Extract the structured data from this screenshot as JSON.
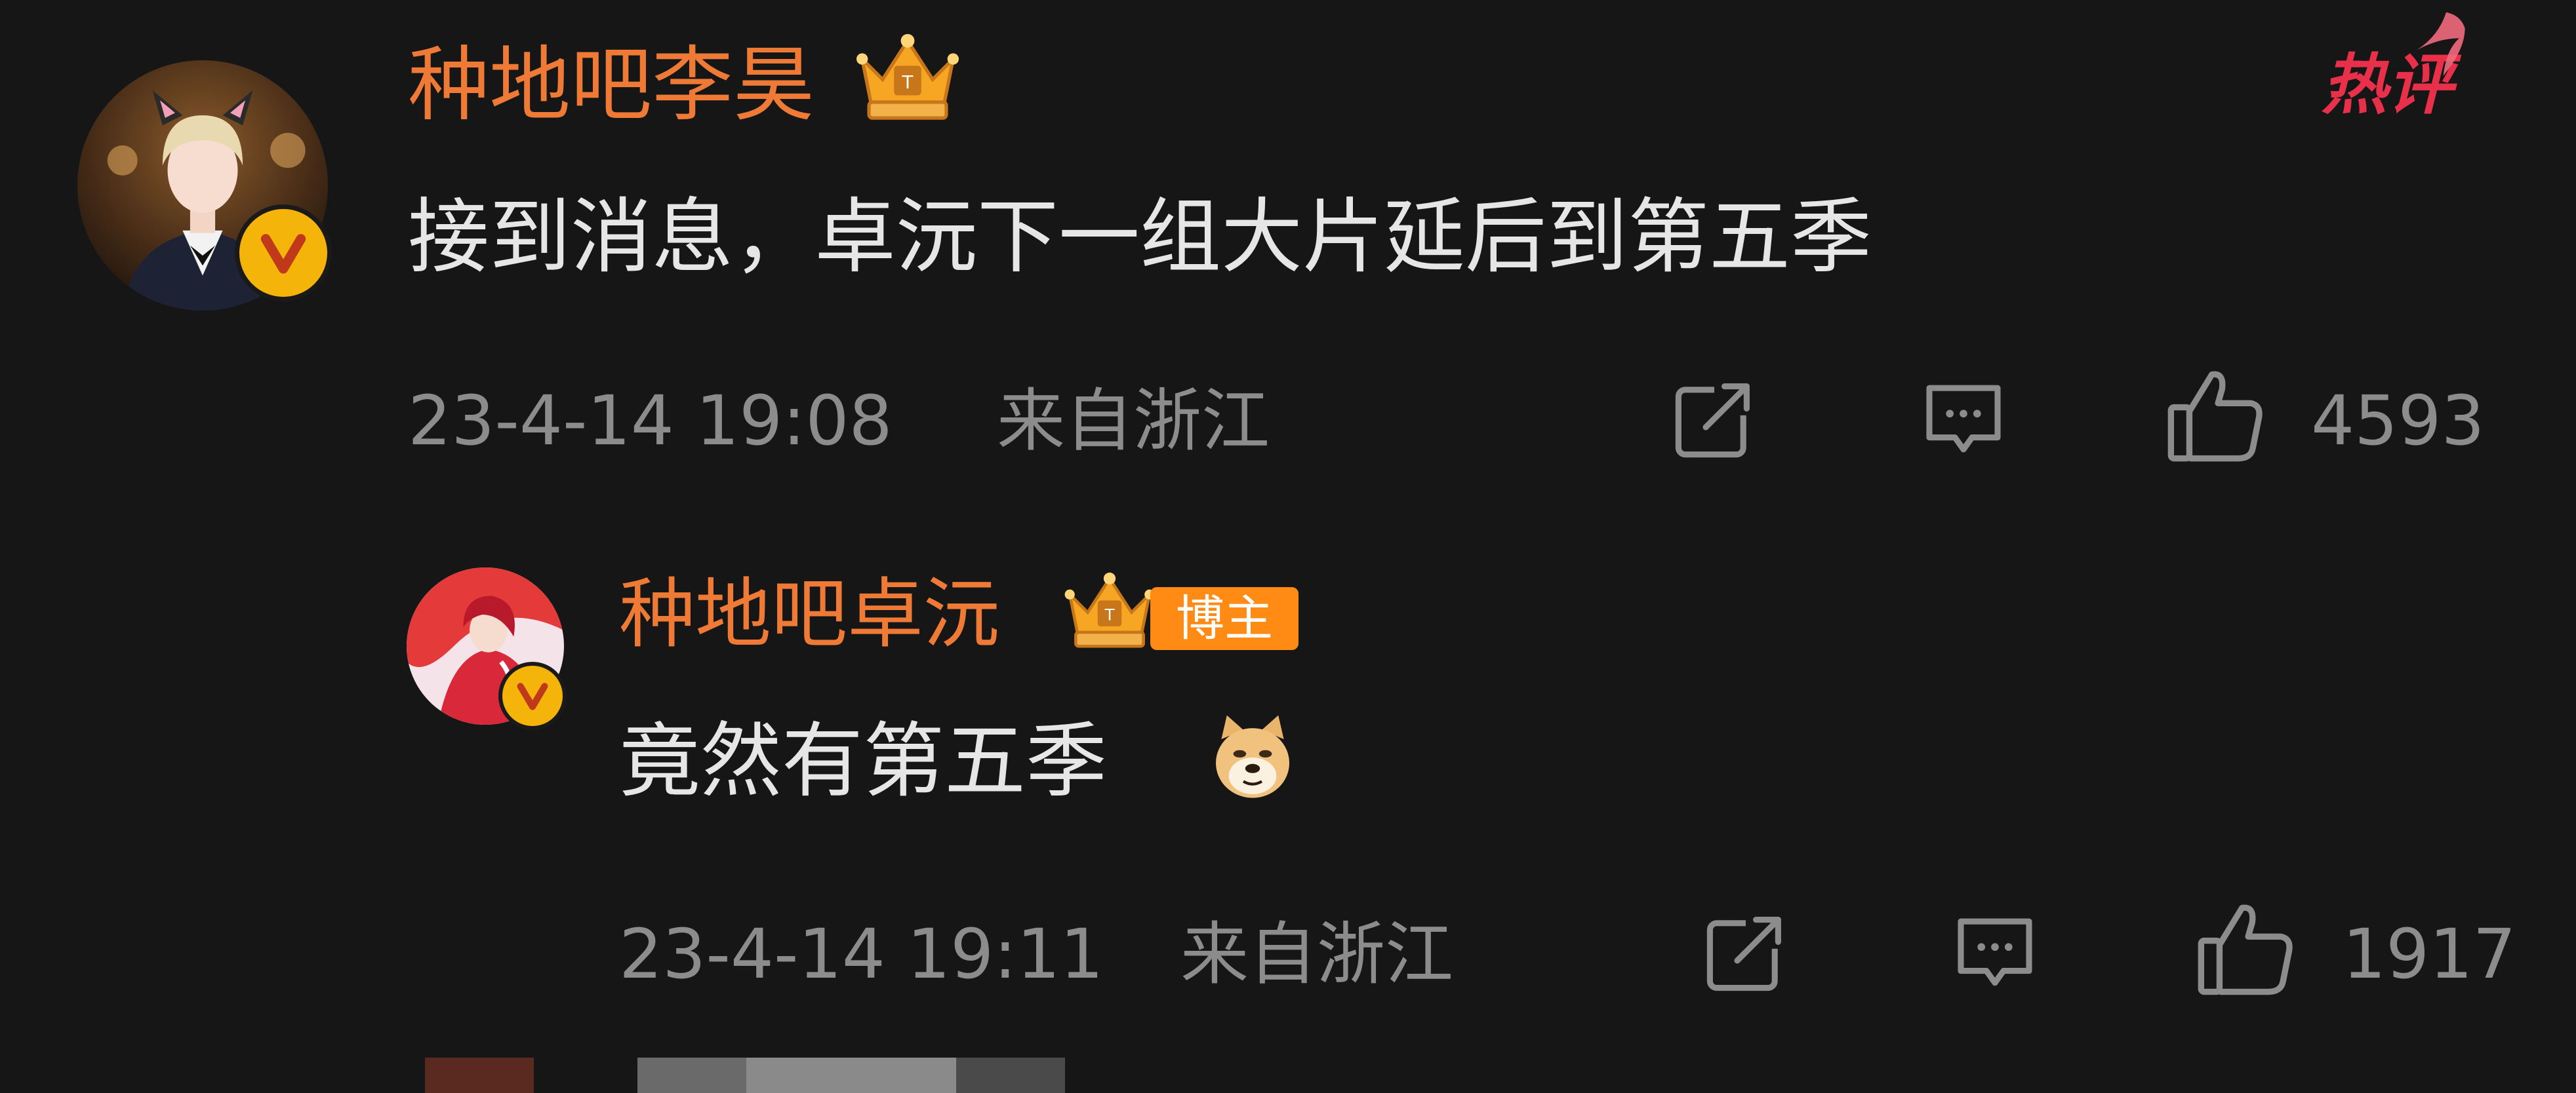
{
  "colors": {
    "background": "#161616",
    "username": "#ee7a36",
    "meta_text": "#8c8c8c",
    "comment_text": "#e6e6e6",
    "verified_badge": "#f5b40a",
    "role_badge": "#ff8a14",
    "hot_tag": "#e8304a"
  },
  "hot_tag": {
    "label": "热评"
  },
  "comments": [
    {
      "username": "种地吧李昊",
      "text": "接到消息，卓沅下一组大片延后到第五季",
      "time": "23-4-14 19:08",
      "location": "来自浙江",
      "likes": "4593",
      "icons": [
        "share-icon",
        "comment-icon",
        "like-icon"
      ]
    },
    {
      "username": "种地吧卓沅",
      "role_badge": "博主",
      "text": "竟然有第五季",
      "emoji": "doge-emoji",
      "time": "23-4-14 19:11",
      "location": "来自浙江",
      "likes": "1917",
      "icons": [
        "share-icon",
        "comment-icon",
        "like-icon"
      ]
    }
  ]
}
